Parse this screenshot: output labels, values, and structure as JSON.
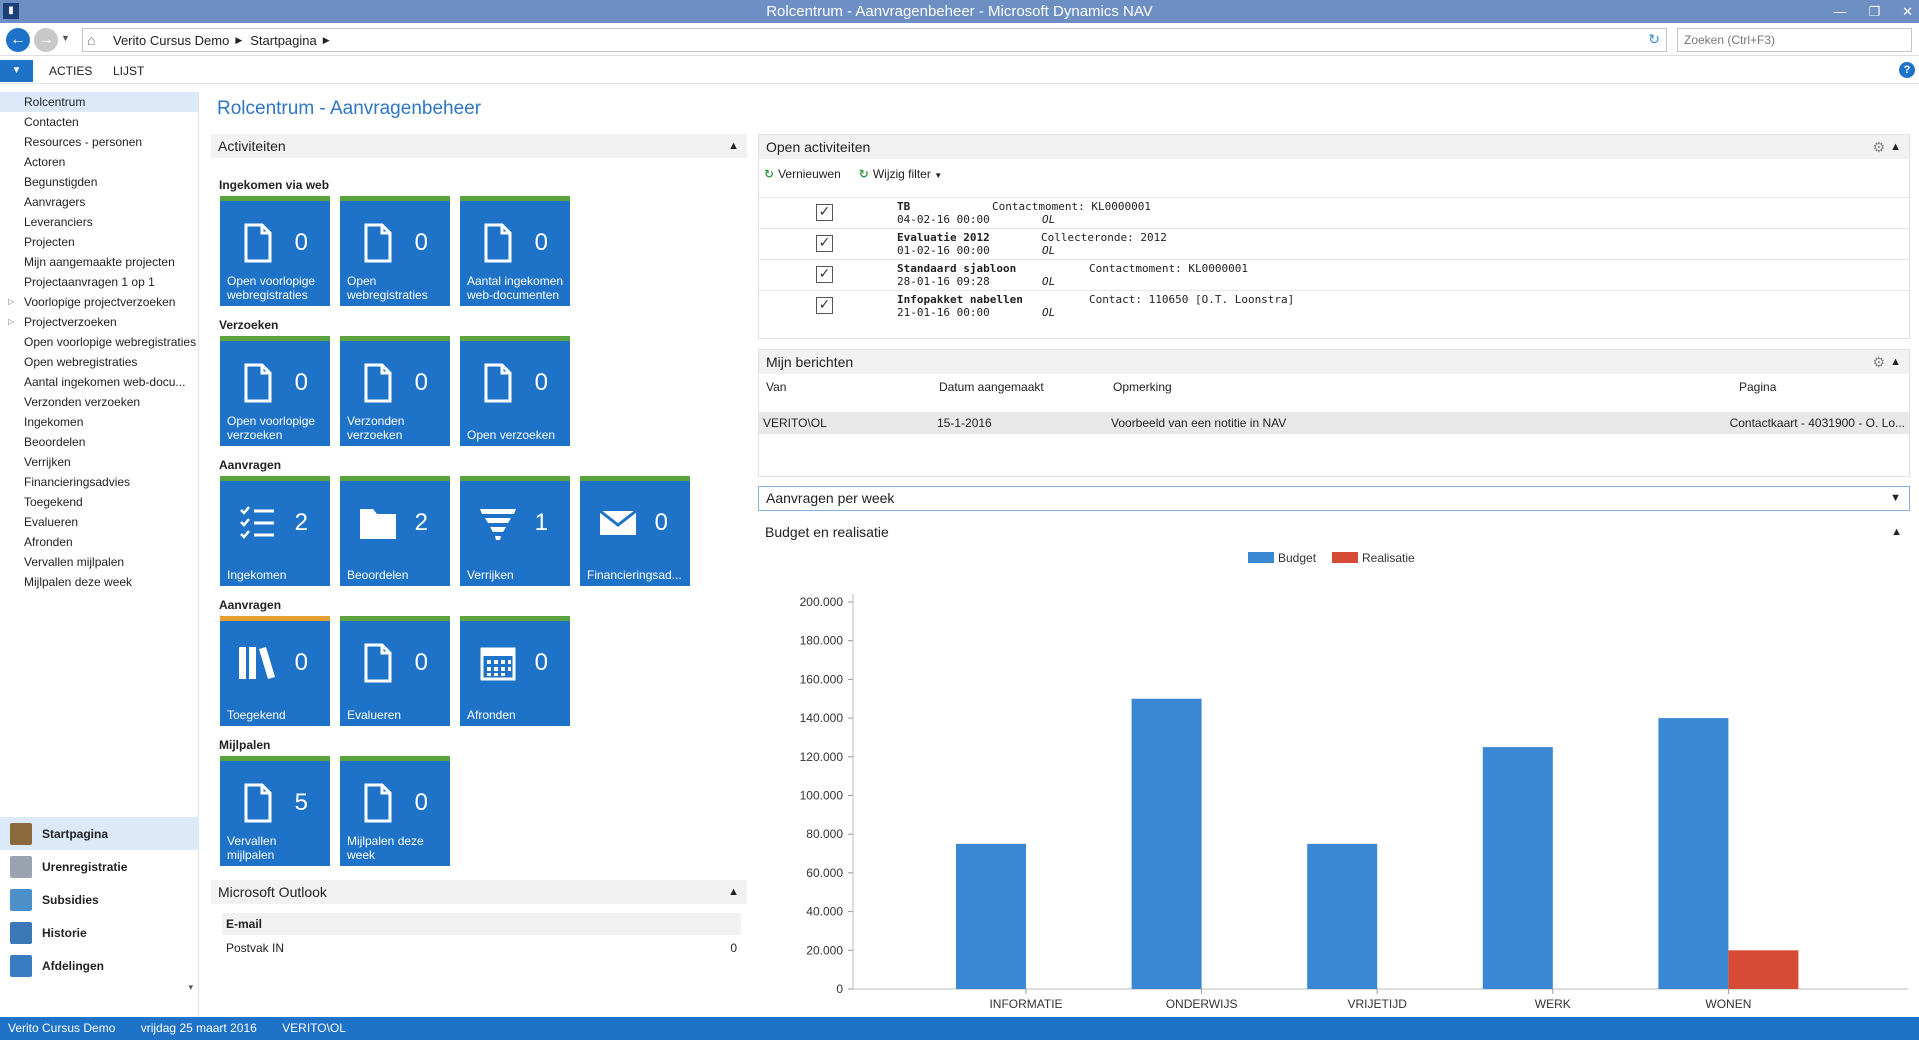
{
  "window": {
    "title": "Rolcentrum - Aanvragenbeheer - Microsoft Dynamics NAV",
    "app_icon": "nav-logo-icon"
  },
  "address": {
    "crumbs": [
      "Verito Cursus Demo",
      "Startpagina"
    ],
    "search_placeholder": "Zoeken (Ctrl+F3)"
  },
  "ribbon": {
    "tabs": [
      "ACTIES",
      "LIJST"
    ]
  },
  "sidebar": {
    "items": [
      "Rolcentrum",
      "Contacten",
      "Resources - personen",
      "Actoren",
      "Begunstigden",
      "Aanvragers",
      "Leveranciers",
      "Projecten",
      "Mijn aangemaakte projecten",
      "Projectaanvragen 1 op 1",
      "Voorlopige projectverzoeken",
      "Projectverzoeken",
      "Open voorlopige webregistraties",
      "Open webregistraties",
      "Aantal ingekomen web-docu...",
      "Verzonden verzoeken",
      "Ingekomen",
      "Beoordelen",
      "Verrijken",
      "Financieringsadvies",
      "Toegekend",
      "Evalueren",
      "Afronden",
      "Vervallen mijlpalen",
      "Mijlpalen deze week"
    ],
    "bottom": [
      "Startpagina",
      "Urenregistratie",
      "Subsidies",
      "Historie",
      "Afdelingen"
    ]
  },
  "page": {
    "title": "Rolcentrum - Aanvragenbeheer"
  },
  "activities": {
    "header": "Activiteiten",
    "groups": [
      {
        "label": "Ingekomen via web",
        "tiles": [
          {
            "count": "0",
            "label": "Open voorlopige webregistraties",
            "icon": "document-icon"
          },
          {
            "count": "0",
            "label": "Open webregistraties",
            "icon": "document-icon"
          },
          {
            "count": "0",
            "label": "Aantal ingekomen web-documenten",
            "icon": "document-icon"
          }
        ]
      },
      {
        "label": "Verzoeken",
        "tiles": [
          {
            "count": "0",
            "label": "Open voorlopige verzoeken",
            "icon": "document-icon"
          },
          {
            "count": "0",
            "label": "Verzonden verzoeken",
            "icon": "document-icon"
          },
          {
            "count": "0",
            "label": "Open verzoeken",
            "icon": "document-icon"
          }
        ]
      },
      {
        "label": "Aanvragen",
        "tiles": [
          {
            "count": "2",
            "label": "Ingekomen",
            "icon": "checklist-icon"
          },
          {
            "count": "2",
            "label": "Beoordelen",
            "icon": "folder-icon"
          },
          {
            "count": "1",
            "label": "Verrijken",
            "icon": "funnel-icon"
          },
          {
            "count": "0",
            "label": "Financieringsad...",
            "icon": "envelope-icon"
          }
        ]
      },
      {
        "label": "Aanvragen",
        "tiles": [
          {
            "count": "0",
            "label": "Toegekend",
            "icon": "books-icon"
          },
          {
            "count": "0",
            "label": "Evalueren",
            "icon": "document-icon"
          },
          {
            "count": "0",
            "label": "Afronden",
            "icon": "calendar-icon"
          }
        ]
      },
      {
        "label": "Mijlpalen",
        "tiles": [
          {
            "count": "5",
            "label": "Vervallen mijlpalen",
            "icon": "document-icon"
          },
          {
            "count": "0",
            "label": "Mijlpalen deze week",
            "icon": "document-icon"
          }
        ]
      }
    ]
  },
  "outlook": {
    "header": "Microsoft Outlook",
    "section": "E-mail",
    "row_label": "Postvak IN",
    "row_value": "0"
  },
  "open_activities": {
    "header": "Open activiteiten",
    "toolbar": [
      "Vernieuwen",
      "Wijzig filter"
    ],
    "rows": [
      {
        "title": "TB",
        "date": "04-02-16 00:00",
        "desc": "Contactmoment: KL0000001",
        "owner": "OL"
      },
      {
        "title": "Evaluatie 2012",
        "date": "01-02-16 00:00",
        "desc": "Collecteronde: 2012",
        "owner": "OL"
      },
      {
        "title": "Standaard sjabloon",
        "date": "28-01-16 09:28",
        "desc": "Contactmoment: KL0000001",
        "owner": "OL"
      },
      {
        "title": "Infopakket nabellen",
        "date": "21-01-16 00:00",
        "desc": "Contact: 110650 [O.T. Loonstra]",
        "owner": "OL"
      }
    ]
  },
  "messages": {
    "header": "Mijn berichten",
    "columns": [
      "Van",
      "Datum aangemaakt",
      "Opmerking",
      "Pagina"
    ],
    "row": [
      "VERITO\\OL",
      "15-1-2016",
      "Voorbeeld van een notitie in NAV",
      "Contactkaart - 4031900 - O. Lo..."
    ]
  },
  "per_week": {
    "header": "Aanvragen per week"
  },
  "budget": {
    "header": "Budget en realisatie"
  },
  "chart_data": {
    "type": "bar",
    "categories": [
      "INFORMATIE",
      "ONDERWIJS",
      "VRIJETIJD",
      "WERK",
      "WONEN"
    ],
    "series": [
      {
        "name": "Budget",
        "values": [
          75000,
          150000,
          75000,
          125000,
          140000
        ],
        "color": "#3a87d4"
      },
      {
        "name": "Realisatie",
        "values": [
          0,
          0,
          0,
          0,
          20000
        ],
        "color": "#d64b36"
      }
    ],
    "ylim": [
      0,
      200000
    ],
    "yticks": [
      "0",
      "20.000",
      "40.000",
      "60.000",
      "80.000",
      "100.000",
      "120.000",
      "140.000",
      "160.000",
      "180.000",
      "200.000"
    ],
    "grid": false,
    "legend": "top-center"
  },
  "status": {
    "company": "Verito Cursus Demo",
    "date": "vrijdag 25 maart 2016",
    "user": "VERITO\\OL"
  }
}
